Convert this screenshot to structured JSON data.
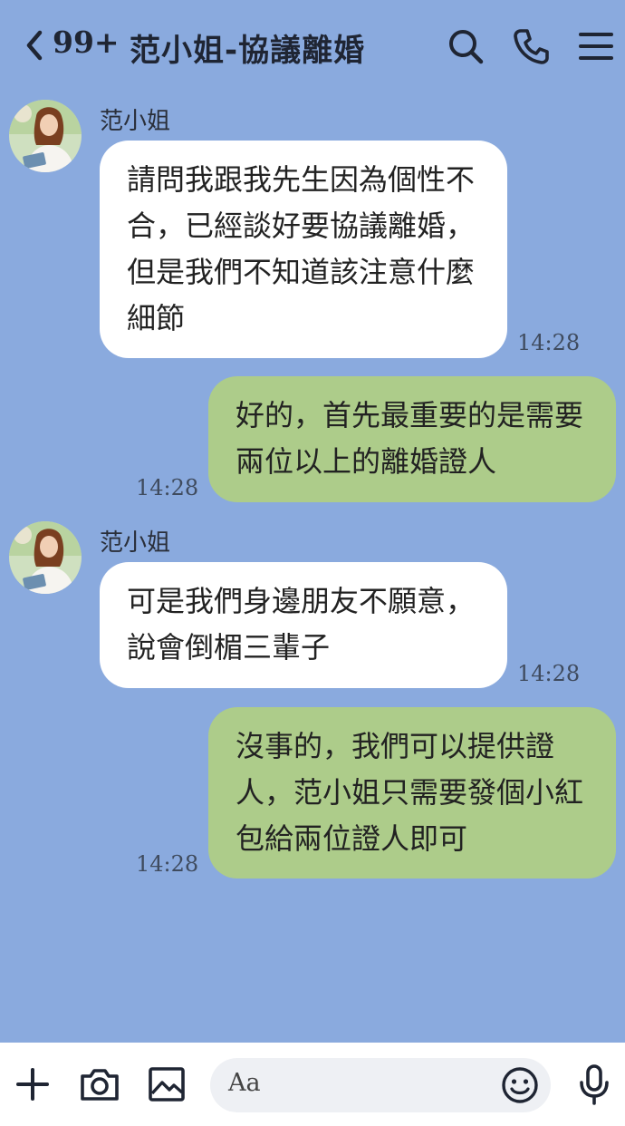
{
  "header": {
    "unread_count": "99+",
    "title": "范小姐-協議離婚"
  },
  "messages": [
    {
      "sender": "范小姐",
      "text": "請問我跟我先生因為個性不合，已經談好要協議離婚，但是我們不知道該注意什麼細節",
      "time": "14:28"
    },
    {
      "text": "好的，首先最重要的是需要兩位以上的離婚證人",
      "time": "14:28"
    },
    {
      "sender": "范小姐",
      "text": "可是我們身邊朋友不願意，說會倒楣三輩子",
      "time": "14:28"
    },
    {
      "text": "沒事的，我們可以提供證人，范小姐只需要發個小紅包給兩位證人即可",
      "time": "14:28"
    }
  ],
  "composer": {
    "placeholder": "Aa"
  },
  "colors": {
    "background": "#8aaade",
    "incoming_bubble": "#ffffff",
    "outgoing_bubble": "#adcc8a"
  },
  "icons": [
    "back-icon",
    "search-icon",
    "phone-icon",
    "menu-icon",
    "plus-icon",
    "camera-icon",
    "image-icon",
    "emoji-icon",
    "microphone-icon"
  ]
}
